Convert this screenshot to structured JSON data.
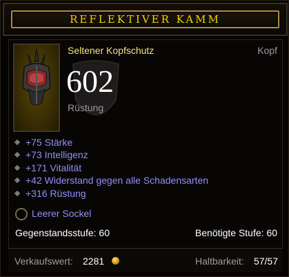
{
  "item": {
    "name": "Reflektiver Kamm",
    "type": "Seltener Kopfschutz",
    "slot": "Kopf",
    "armor_value": "602",
    "armor_label": "Rüstung",
    "affixes": [
      "+75 Stärke",
      "+73 Intelligenz",
      "+171 Vitalität",
      "+42 Widerstand gegen alle Schadensarten",
      "+316 Rüstung"
    ],
    "socket": "Leerer Sockel",
    "item_level": "Gegenstandsstufe: 60",
    "required_level": "Benötigte Stufe: 60"
  },
  "footer": {
    "sell_label": "Verkaufswert:",
    "sell_value": "2281",
    "durability_label": "Haltbarkeit:",
    "durability_value": "57/57"
  },
  "icons": {
    "item": "helmet-icon",
    "currency": "gold-coin-icon",
    "socket": "empty-socket-icon",
    "affix_bullet": "diamond-bullet-icon"
  },
  "colors": {
    "title": "#f2d100",
    "item_type_rare": "#f3e37a",
    "magic_affix": "#8f8ff7",
    "muted": "#9a9a9a"
  }
}
